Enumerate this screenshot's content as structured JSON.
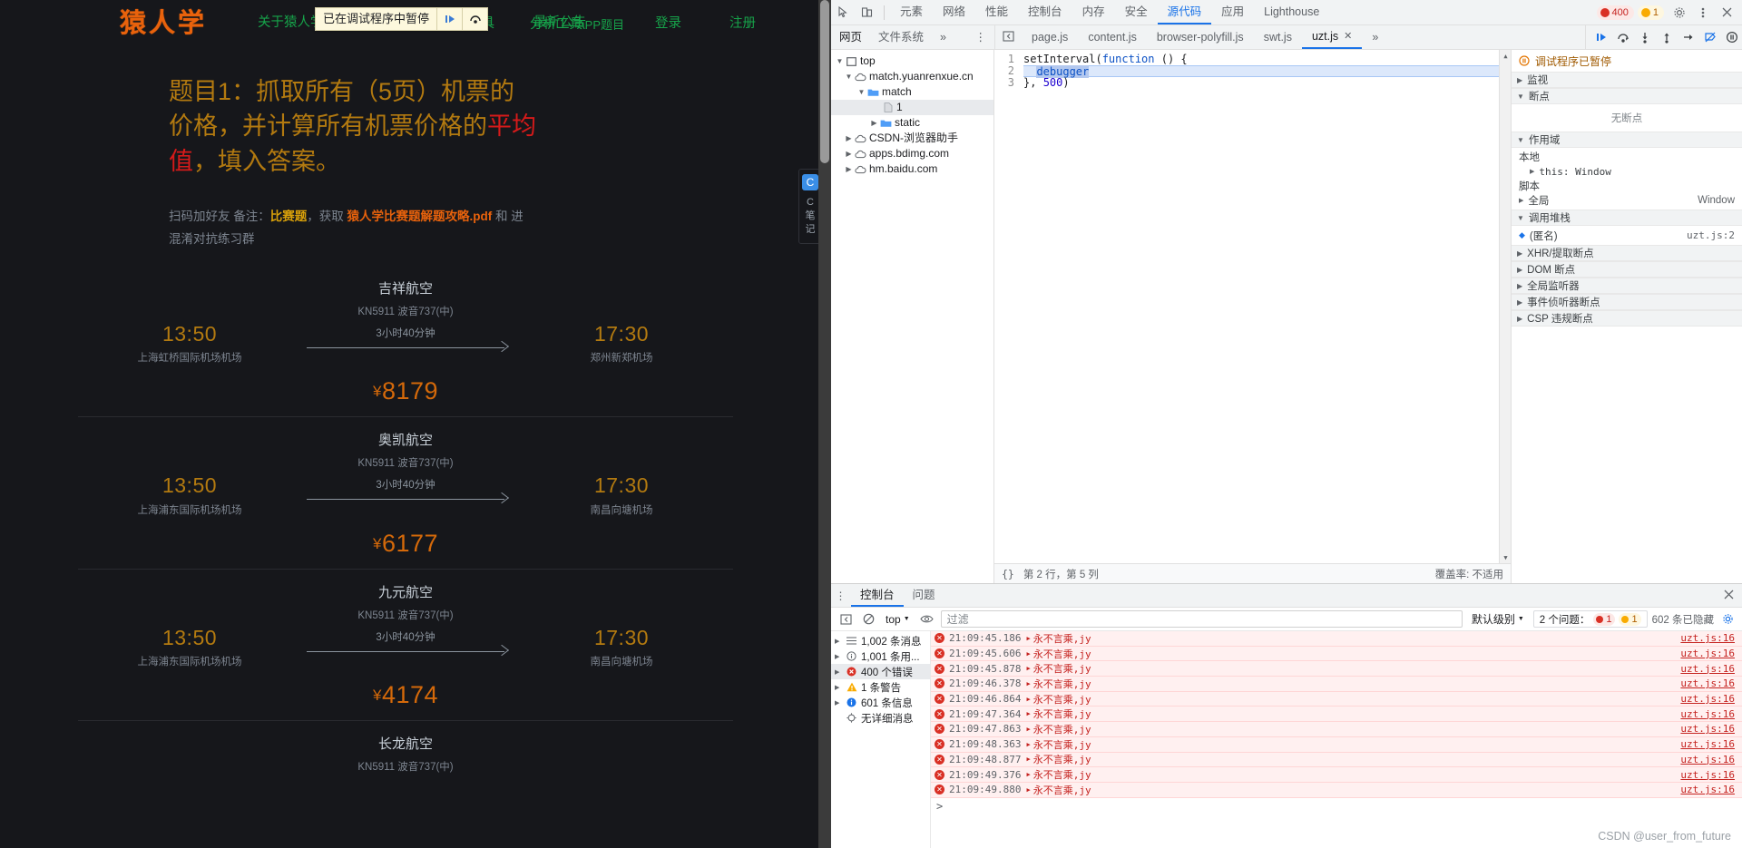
{
  "site": {
    "logo": "猿人学",
    "nav": [
      {
        "label": "关于猿人学"
      },
      {
        "label": "工具"
      },
      {
        "label": "分析工具"
      },
      {
        "label": "最新公告"
      },
      {
        "label": "APP题目"
      },
      {
        "label": "登录"
      },
      {
        "label": "注册"
      }
    ],
    "paused_chip": {
      "text": "已在调试程序中暂停",
      "resume_icon": "resume-icon",
      "step-over_icon": "step-over-icon"
    },
    "question": {
      "line1": "题目1：抓取所有（5页）机票的",
      "line2": "价格，并计算所有机票价格的",
      "highlight1": "平均",
      "highlight2": "值",
      "line3": "，填入答案。"
    },
    "note": {
      "p1": "扫码加好友 备注：",
      "b1": "比赛题",
      "p2": "，获取 ",
      "b2": "猿人学比赛题解题攻略.pdf",
      "p3": " 和 进",
      "p4": "混淆对抗练习群"
    },
    "notes_tab": {
      "icon": "note-icon",
      "text": "C\n笔\n记",
      "line1": "C",
      "line2": "笔",
      "line3": "记"
    },
    "flights": [
      {
        "airline": "吉祥航空",
        "plane": "KN5911 波音737(中)",
        "dep_time": "13:50",
        "dep_airport": "上海虹桥国际机场机场",
        "duration": "3小时40分钟",
        "arr_time": "17:30",
        "arr_airport": "郑州新郑机场",
        "price": "8179",
        "currency": "¥"
      },
      {
        "airline": "奥凯航空",
        "plane": "KN5911 波音737(中)",
        "dep_time": "13:50",
        "dep_airport": "上海浦东国际机场机场",
        "duration": "3小时40分钟",
        "arr_time": "17:30",
        "arr_airport": "南昌向塘机场",
        "price": "6177",
        "currency": "¥"
      },
      {
        "airline": "九元航空",
        "plane": "KN5911 波音737(中)",
        "dep_time": "13:50",
        "dep_airport": "上海浦东国际机场机场",
        "duration": "3小时40分钟",
        "arr_time": "17:30",
        "arr_airport": "南昌向塘机场",
        "price": "4174",
        "currency": "¥"
      },
      {
        "airline": "长龙航空",
        "plane": "KN5911 波音737(中)",
        "dep_time": "",
        "dep_airport": "",
        "duration": "",
        "arr_time": "",
        "arr_airport": "",
        "price": "",
        "currency": ""
      }
    ]
  },
  "devtools": {
    "toolbar": {
      "inspect_icon": "inspect-icon",
      "device_icon": "device-toolbar-icon",
      "tabs": [
        {
          "label": "元素",
          "active": false
        },
        {
          "label": "网络",
          "active": false
        },
        {
          "label": "性能",
          "active": false
        },
        {
          "label": "控制台",
          "active": false
        },
        {
          "label": "内存",
          "active": false
        },
        {
          "label": "安全",
          "active": false
        },
        {
          "label": "源代码",
          "active": true
        },
        {
          "label": "应用",
          "active": false
        },
        {
          "label": "Lighthouse",
          "active": false
        }
      ],
      "error_badge": "400",
      "warn_badge": "1",
      "settings_icon": "gear-icon",
      "more_icon": "kebab-icon",
      "close_icon": "close-icon"
    },
    "sources": {
      "nav_tabs": [
        {
          "label": "网页",
          "active": true
        },
        {
          "label": "文件系统",
          "active": false
        },
        {
          "label": "»",
          "active": false
        }
      ],
      "more_icon": "kebab-icon",
      "collapse_icon": "collapse-sidebar-icon",
      "file_tabs": [
        {
          "label": "page.js",
          "active": false
        },
        {
          "label": "content.js",
          "active": false
        },
        {
          "label": "browser-polyfill.js",
          "active": false
        },
        {
          "label": "swt.js",
          "active": false
        },
        {
          "label": "uzt.js",
          "active": true,
          "close": "✕"
        }
      ],
      "overflow": "»",
      "tree": [
        {
          "label": "top",
          "depth": 0,
          "icon": "frame-icon",
          "expanded": true,
          "selected": false
        },
        {
          "label": "match.yuanrenxue.cn",
          "depth": 1,
          "icon": "cloud-icon",
          "expanded": true,
          "selected": false
        },
        {
          "label": "match",
          "depth": 2,
          "icon": "folder-icon",
          "expanded": true,
          "selected": false
        },
        {
          "label": "1",
          "depth": 3,
          "icon": "file-icon",
          "expanded": false,
          "selected": true
        },
        {
          "label": "static",
          "depth": 3,
          "icon": "folder-icon",
          "expanded": false,
          "selected": false
        },
        {
          "label": "CSDN-浏览器助手",
          "depth": 1,
          "icon": "cloud-icon",
          "expanded": false,
          "selected": false
        },
        {
          "label": "apps.bdimg.com",
          "depth": 1,
          "icon": "cloud-icon",
          "expanded": false,
          "selected": false
        },
        {
          "label": "hm.baidu.com",
          "depth": 1,
          "icon": "cloud-icon",
          "expanded": false,
          "selected": false
        }
      ],
      "code_lines": [
        {
          "n": "1",
          "text": "setInterval(function () {",
          "hl": false
        },
        {
          "n": "2",
          "text": "  debugger",
          "hl": true
        },
        {
          "n": "3",
          "text": "}, 500)",
          "hl": false
        }
      ],
      "status_brace": "{}",
      "status_pos": "第 2 行，第 5 列",
      "status_coverage": "覆盖率: 不适用"
    },
    "debugger": {
      "buttons": [
        {
          "icon": "resume-icon",
          "name": "resume-button"
        },
        {
          "icon": "step-over-icon",
          "name": "step-over-button"
        },
        {
          "icon": "step-into-icon",
          "name": "step-into-button"
        },
        {
          "icon": "step-out-icon",
          "name": "step-out-button"
        },
        {
          "icon": "step-icon",
          "name": "step-button"
        },
        {
          "icon": "deactivate-breakpoints-icon",
          "name": "deactivate-breakpoints-button"
        },
        {
          "icon": "pause-on-exceptions-icon",
          "name": "pause-on-exceptions-button"
        }
      ],
      "paused_banner": "调试程序已暂停",
      "paused_icon": "pause-circle-icon",
      "sections": [
        {
          "title": "监视",
          "expanded": false
        },
        {
          "title": "断点",
          "expanded": true,
          "empty": "无断点"
        },
        {
          "title": "作用域",
          "expanded": true
        },
        {
          "title": "调用堆栈",
          "expanded": true
        },
        {
          "title": "XHR/提取断点",
          "expanded": false
        },
        {
          "title": "DOM 断点",
          "expanded": false
        },
        {
          "title": "全局监听器",
          "expanded": false
        },
        {
          "title": "事件侦听器断点",
          "expanded": false
        },
        {
          "title": "CSP 违规断点",
          "expanded": false
        }
      ],
      "scope": {
        "local_label": "本地",
        "this_label": "this: Window",
        "script_label": "脚本",
        "global_label": "全局",
        "global_value": "Window"
      },
      "call_stack": [
        {
          "name": "(匿名)",
          "location": "uzt.js:2"
        }
      ]
    },
    "console": {
      "drawer_tabs": [
        {
          "label": "控制台",
          "active": true
        },
        {
          "label": "问题",
          "active": false
        }
      ],
      "kebab_icon": "kebab-icon",
      "close_icon": "close-icon",
      "toolbar": {
        "sidebar_icon": "console-sidebar-icon",
        "clear_icon": "clear-console-icon",
        "context": "top",
        "eye_icon": "eye-icon",
        "filter_placeholder": "过滤",
        "level": "默认级别",
        "issues_text": "2 个问题：",
        "issues_err": "1",
        "issues_warn": "1",
        "hidden_count": "602 条已隐藏",
        "settings_icon": "gear-icon"
      },
      "sidebar": [
        {
          "label": "1,002 条消息",
          "icon": "list-icon",
          "selected": false
        },
        {
          "label": "1,001 条用...",
          "icon": "info-circle-icon",
          "selected": false
        },
        {
          "label": "400 个错误",
          "icon": "error-icon",
          "selected": true
        },
        {
          "label": "1 条警告",
          "icon": "warning-icon",
          "selected": false
        },
        {
          "label": "601 条信息",
          "icon": "info-icon",
          "selected": false
        },
        {
          "label": "无详细消息",
          "icon": "verbose-icon",
          "selected": false
        }
      ],
      "messages": [
        {
          "time": "21:09:45.186",
          "text": "永不言乘,jy",
          "source": "uzt.js:16"
        },
        {
          "time": "21:09:45.606",
          "text": "永不言乘,jy",
          "source": "uzt.js:16"
        },
        {
          "time": "21:09:45.878",
          "text": "永不言乘,jy",
          "source": "uzt.js:16"
        },
        {
          "time": "21:09:46.378",
          "text": "永不言乘,jy",
          "source": "uzt.js:16"
        },
        {
          "time": "21:09:46.864",
          "text": "永不言乘,jy",
          "source": "uzt.js:16"
        },
        {
          "time": "21:09:47.364",
          "text": "永不言乘,jy",
          "source": "uzt.js:16"
        },
        {
          "time": "21:09:47.863",
          "text": "永不言乘,jy",
          "source": "uzt.js:16"
        },
        {
          "time": "21:09:48.363",
          "text": "永不言乘,jy",
          "source": "uzt.js:16"
        },
        {
          "time": "21:09:48.877",
          "text": "永不言乘,jy",
          "source": "uzt.js:16"
        },
        {
          "time": "21:09:49.376",
          "text": "永不言乘,jy",
          "source": "uzt.js:16"
        },
        {
          "time": "21:09:49.880",
          "text": "永不言乘,jy",
          "source": "uzt.js:16"
        }
      ],
      "prompt": ">"
    }
  },
  "watermark": "CSDN @user_from_future"
}
